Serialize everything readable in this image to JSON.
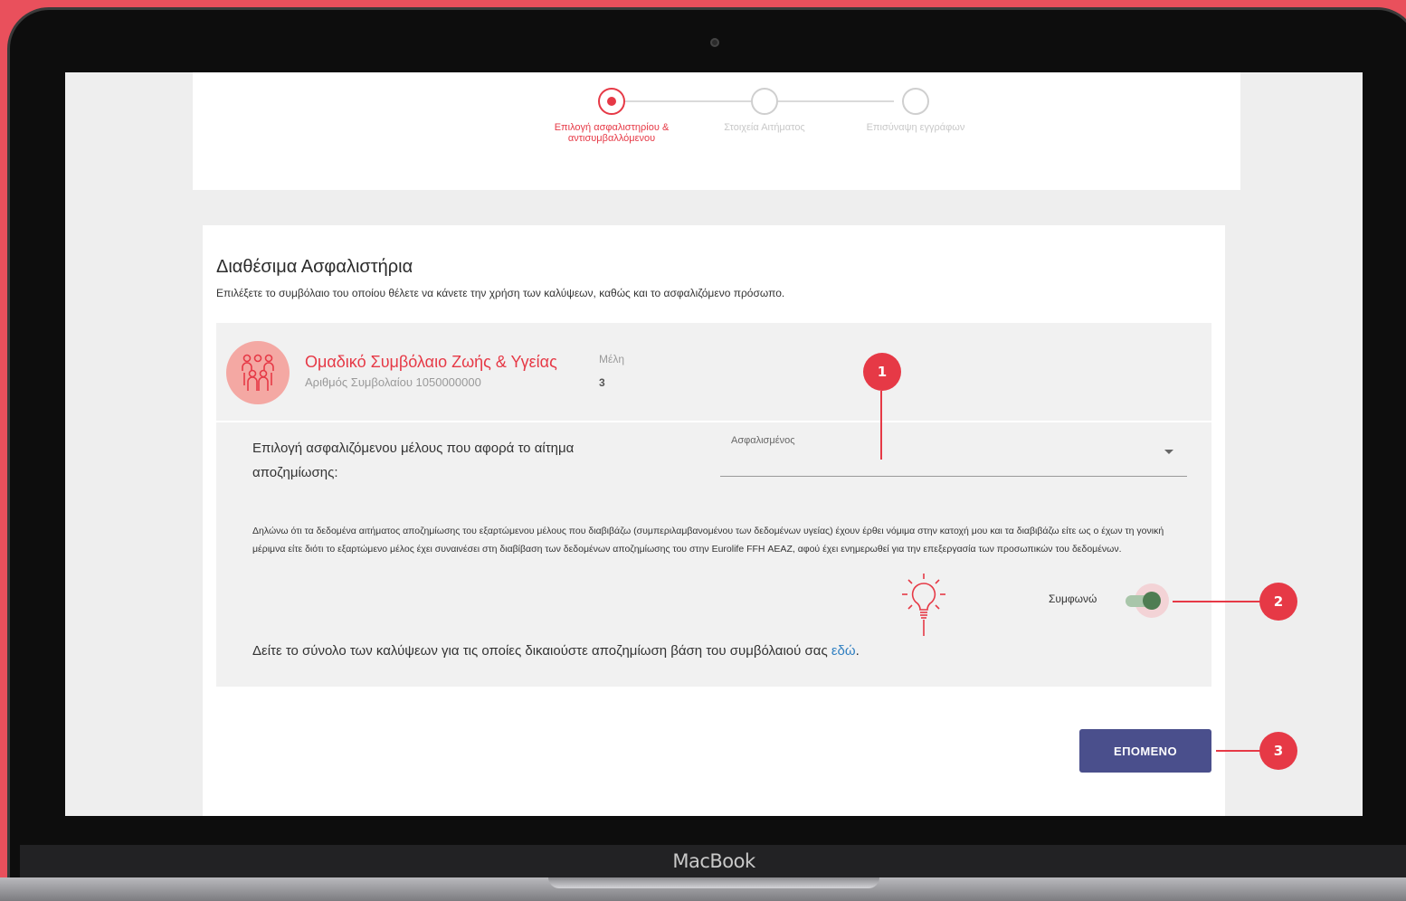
{
  "device": {
    "label": "MacBook"
  },
  "stepper": {
    "steps": [
      {
        "label_line1": "Επιλογή ασφαλιστηρίου &",
        "label_line2": "αντισυμβαλλόμενου",
        "active": true
      },
      {
        "label_line1": "Στοιχεία Αιτήματος",
        "label_line2": "",
        "active": false
      },
      {
        "label_line1": "Επισύναψη εγγράφων",
        "label_line2": "",
        "active": false
      }
    ]
  },
  "main": {
    "title": "Διαθέσιμα Ασφαλιστήρια",
    "subtitle": "Επιλέξετε το συμβόλαιο του οποίου θέλετε να κάνετε την χρήση των καλύψεων, καθώς και το ασφαλιζόμενο πρόσωπο."
  },
  "policy": {
    "name": "Ομαδικό Συμβόλαιο Ζωής & Υγείας",
    "number_text": "Αριθμός Συμβολαίου 1050000000",
    "members_label": "Μέλη",
    "members_value": "3"
  },
  "member_select": {
    "question": "Επιλογή ασφαλιζόμενου μέλους που αφορά το αίτημα αποζημίωσης:",
    "dropdown_label": "Ασφαλισμένος"
  },
  "declaration": {
    "text": "Δηλώνω ότι τα δεδομένα αιτήματος αποζημίωσης του εξαρτώμενου μέλους που διαβιβάζω (συμπεριλαμβανομένου των δεδομένων υγείας) έχουν έρθει νόμιμα στην κατοχή μου και τα διαβιβάζω είτε ως ο έχων τη γονική μέριμνα είτε διότι το εξαρτώμενο μέλος έχει συναινέσει στη διαβίβαση των δεδομένων αποζημίωσης του στην Eurolife FFH ΑΕΑΖ, αφού έχει ενημερωθεί για την επεξεργασία των προσωπικών του δεδομένων.",
    "agree_label": "Συμφωνώ",
    "agree_on": true
  },
  "coverage": {
    "text": "Δείτε το σύνολο των καλύψεων για τις οποίες δικαιούστε αποζημίωση βάση του συμβόλαιού σας ",
    "link": "εδώ",
    "suffix": "."
  },
  "actions": {
    "next_label": "ΕΠΟΜΕΝΟ"
  },
  "callouts": [
    "1",
    "2",
    "3"
  ],
  "colors": {
    "accent": "#e63946",
    "button": "#4a4f8c",
    "toggle": "#4e7d52",
    "link": "#2f7fc1",
    "frame": "#e9505c"
  }
}
